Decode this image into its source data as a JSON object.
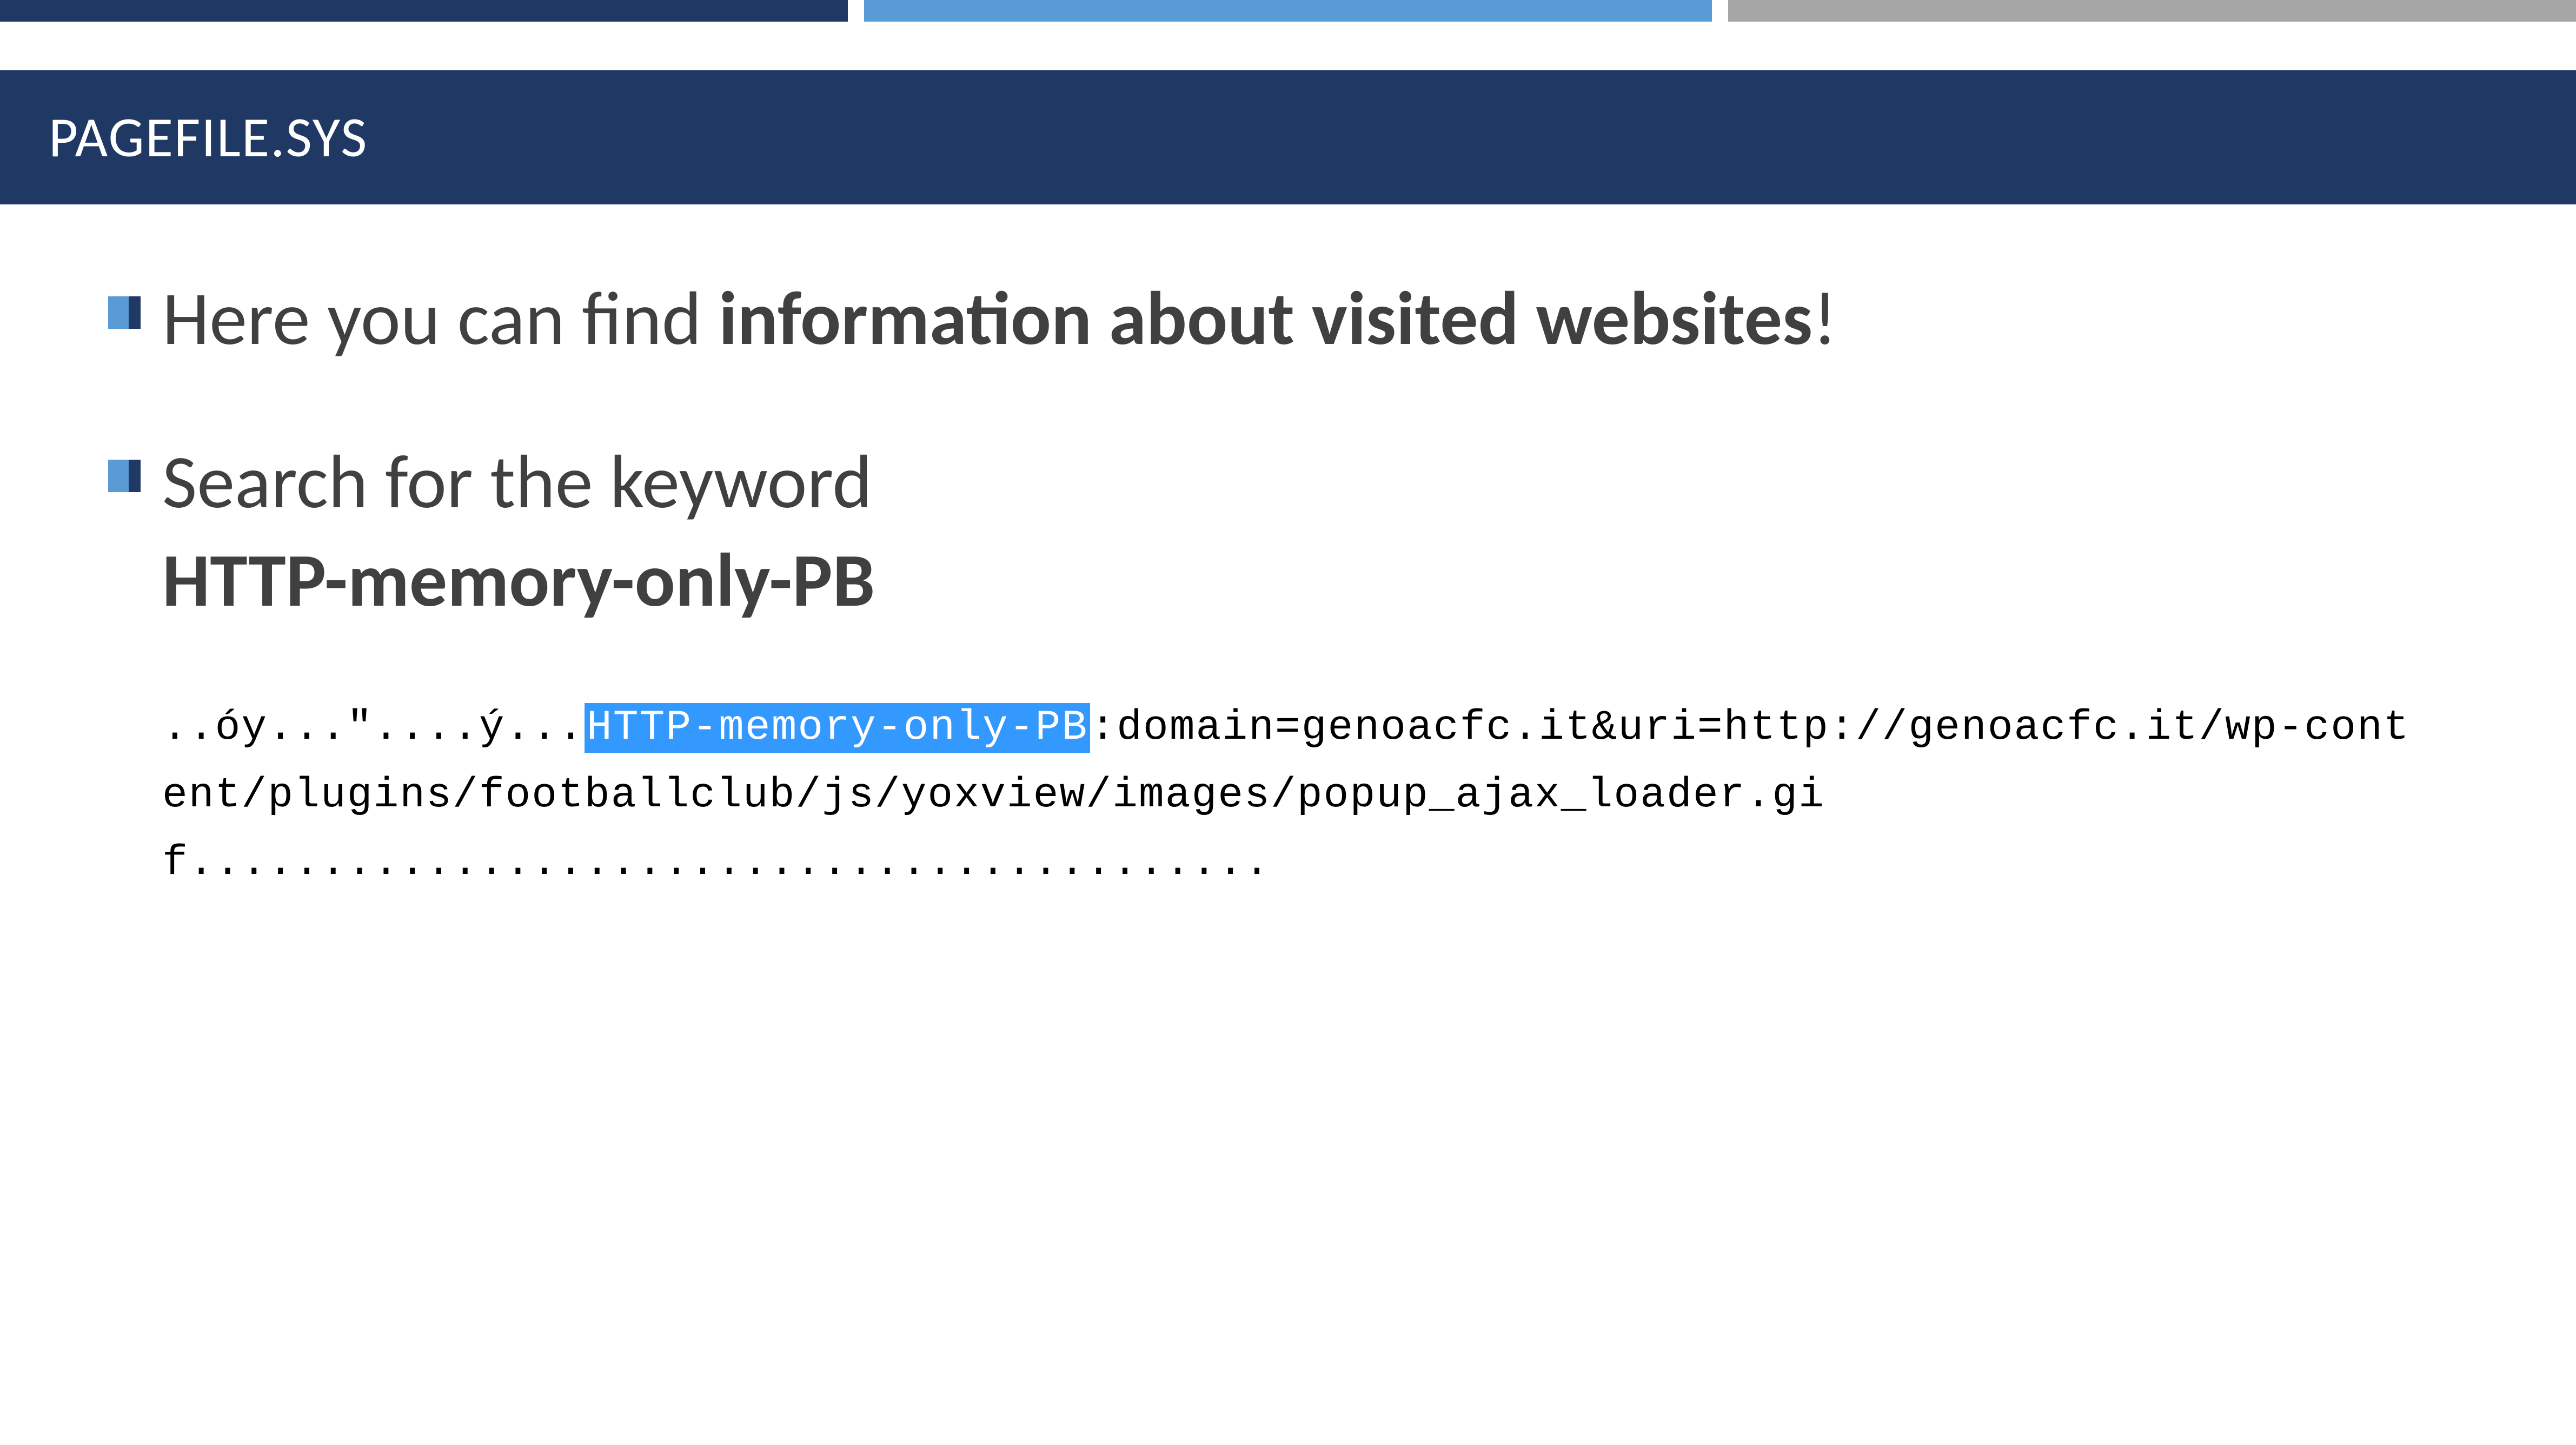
{
  "header": {
    "title": "PAGEFILE.SYS"
  },
  "bullets": [
    {
      "prefix": "Here you can find ",
      "bold": "information about visited websites",
      "suffix": "!"
    },
    {
      "prefix": "Search for the keyword ",
      "bold": "HTTP-memory-only-PB",
      "suffix": ""
    }
  ],
  "hexdump": {
    "line_prefix": "..óy...\"....ý...",
    "highlighted": "HTTP-memory-only-PB",
    "line_rest": ":domain=genoacfc.it&uri=http://genoacfc.it/wp-content/plugins/footballclub/js/yoxview/images/popup_ajax_loader.gif........................................."
  },
  "colors": {
    "navy": "#1f3864",
    "blue": "#5b9bd5",
    "gray": "#a6a6a6",
    "highlight": "#3399ff",
    "text": "#404040"
  }
}
